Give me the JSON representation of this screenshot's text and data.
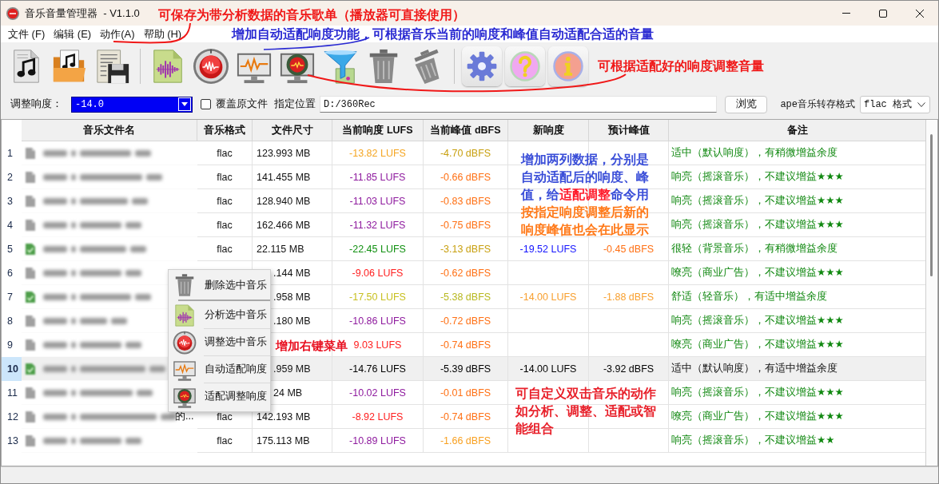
{
  "window": {
    "title": "音乐音量管理器  - V1.1.0"
  },
  "menu": [
    {
      "label": "文件 (F)"
    },
    {
      "label": "编辑 (E)"
    },
    {
      "label": "动作(A)"
    },
    {
      "label": "帮助 (H)"
    }
  ],
  "options": {
    "loudness": {
      "label": "调整响度：",
      "value": "-14.0",
      "highlighted": true
    },
    "overwrite": {
      "label": "覆盖原文件",
      "checked": false
    },
    "location": {
      "label": "指定位置",
      "value": "D:/360Rec"
    },
    "browse_button": "浏览",
    "ape_format": {
      "label": "ape音乐转存格式",
      "value": "flac 格式"
    }
  },
  "table": {
    "columns": [
      "音乐文件名",
      "音乐格式",
      "文件尺寸",
      "当前响度 LUFS",
      "当前峰值 dBFS",
      "新响度",
      "预计峰值",
      "备注"
    ],
    "rows": [
      {
        "number": "1",
        "processed": false,
        "selected": false,
        "format": "flac",
        "size": "123.993 MB",
        "lufs": {
          "text": "-13.82 LUFS",
          "color": "#f5a623"
        },
        "peak": {
          "text": "-4.70 dBFS",
          "color": "#c8a010"
        },
        "note": "适中（默认响度），有稍微增益余度"
      },
      {
        "number": "2",
        "processed": false,
        "selected": false,
        "format": "flac",
        "size": "141.455 MB",
        "lufs": {
          "text": "-11.85 LUFS",
          "color": "#8e1a9e"
        },
        "peak": {
          "text": "-0.66 dBFS",
          "color": "#ff7014"
        },
        "note": "响亮（摇滚音乐），不建议增益★★★"
      },
      {
        "number": "3",
        "processed": false,
        "selected": false,
        "format": "flac",
        "size": "128.940 MB",
        "lufs": {
          "text": "-11.03 LUFS",
          "color": "#8e1a9e"
        },
        "peak": {
          "text": "-0.83 dBFS",
          "color": "#ff7014"
        },
        "note": "响亮（摇滚音乐），不建议增益★★★"
      },
      {
        "number": "4",
        "processed": false,
        "selected": false,
        "format": "flac",
        "size": "162.466 MB",
        "lufs": {
          "text": "-11.32 LUFS",
          "color": "#8e1a9e"
        },
        "peak": {
          "text": "-0.75 dBFS",
          "color": "#ff7014"
        },
        "note": "响亮（摇滚音乐），不建议增益★★★"
      },
      {
        "number": "5",
        "processed": true,
        "selected": false,
        "format": "flac",
        "size": "22.115 MB",
        "lufs": {
          "text": "-22.45 LUFS",
          "color": "#109010"
        },
        "peak": {
          "text": "-3.13 dBFS",
          "color": "#c8a010"
        },
        "new_lufs": {
          "text": "-19.52 LUFS",
          "color": "#1414ff"
        },
        "new_peak": {
          "text": "-0.45 dBFS",
          "color": "#ff7014"
        },
        "note": "很轻（背景音乐），有稍微增益余度"
      },
      {
        "number": "6",
        "processed": false,
        "selected": false,
        "size": ".144 MB",
        "lufs": {
          "text": "-9.06 LUFS",
          "color": "#ff1e1e"
        },
        "peak": {
          "text": "-0.62 dBFS",
          "color": "#ff7014"
        },
        "note": "嘹亮（商业广告），不建议增益★★★"
      },
      {
        "number": "7",
        "processed": true,
        "selected": false,
        "size": ".958 MB",
        "lufs": {
          "text": "-17.50 LUFS",
          "color": "#c8c020"
        },
        "peak": {
          "text": "-5.38 dBFS",
          "color": "#b8b820"
        },
        "new_lufs": {
          "text": "-14.00 LUFS",
          "color": "#f8a030"
        },
        "new_peak": {
          "text": "-1.88 dBFS",
          "color": "#f8a030"
        },
        "note": "舒适（轻音乐），有适中增益余度"
      },
      {
        "number": "8",
        "processed": false,
        "selected": false,
        "size": ".180 MB",
        "lufs": {
          "text": "-10.86 LUFS",
          "color": "#8e1a9e"
        },
        "peak": {
          "text": "-0.72 dBFS",
          "color": "#ff7014"
        },
        "note": "响亮（摇滚音乐），不建议增益★★★"
      },
      {
        "number": "9",
        "processed": false,
        "selected": false,
        "lufs": {
          "text": "9.03 LUFS",
          "color": "#ff1e1e"
        },
        "peak": {
          "text": "-0.74 dBFS",
          "color": "#ff7014"
        },
        "note": "嘹亮（商业广告），不建议增益★★★"
      },
      {
        "number": "10",
        "processed": true,
        "selected": true,
        "size": ".959 MB",
        "lufs": {
          "text": "-14.76 LUFS",
          "color": "#000000"
        },
        "peak": {
          "text": "-5.39 dBFS",
          "color": "#000000"
        },
        "new_lufs": {
          "text": "-14.00 LUFS",
          "color": "#000000"
        },
        "new_peak": {
          "text": "-3.92 dBFS",
          "color": "#000000"
        },
        "note": "适中（默认响度），有适中增益余度"
      },
      {
        "number": "11",
        "processed": false,
        "selected": false,
        "size": "24 MB",
        "lufs": {
          "text": "-10.02 LUFS",
          "color": "#8e1a9e"
        },
        "peak": {
          "text": "-0.01 dBFS",
          "color": "#ff7014"
        },
        "note": "响亮（摇滚音乐），不建议增益★★★"
      },
      {
        "number": "12",
        "processed": false,
        "selected": false,
        "name_tail": "的...",
        "format": "flac",
        "size": "142.193 MB",
        "lufs": {
          "text": "-8.92 LUFS",
          "color": "#ff1e1e"
        },
        "peak": {
          "text": "-0.74 dBFS",
          "color": "#ff7014"
        },
        "note": "嘹亮（商业广告），不建议增益★★★"
      },
      {
        "number": "13",
        "processed": false,
        "selected": false,
        "format": "flac",
        "size": "175.113 MB",
        "lufs": {
          "text": "-10.89 LUFS",
          "color": "#8e1a9e"
        },
        "peak": {
          "text": "-1.66 dBFS",
          "color": "#f8a020"
        },
        "note": "响亮（摇滚音乐），不建议增益★★"
      }
    ]
  },
  "context_menu": {
    "sections": [
      [
        {
          "label": "删除选中音乐"
        }
      ],
      [
        {
          "label": "分析选中音乐"
        },
        {
          "label": "调整选中音乐"
        },
        {
          "label": "自动适配响度"
        },
        {
          "label": "适配调整响度"
        }
      ]
    ]
  },
  "annotations": [
    {
      "segments": [
        {
          "text": "可保存为带分析数据的音乐歌单（播放器可直接使用）",
          "color": "#f01818"
        }
      ]
    },
    {
      "segments": [
        {
          "text": "增加自动适配响度功能，可根据音乐当前的响度和峰值自动适配合适的音量",
          "color": "#2a2ad2"
        }
      ]
    },
    {
      "segments": [
        {
          "text": "可根据适配好的响度调整音量",
          "color": "#f01818"
        }
      ]
    },
    {
      "segments": [
        {
          "text": "增加两列数据，分别是自动适配后的响度、峰值，给",
          "color": "#3a4ed8"
        },
        {
          "text": "适配调整",
          "color": "#ff1a2a"
        },
        {
          "text": "命令用",
          "color": "#3a4ed8"
        },
        {
          "text": "按指定响度调整后新的响度峰值也会在此显示",
          "color": "#ff7a1a"
        }
      ]
    },
    {
      "segments": [
        {
          "text": "增加右键菜单",
          "color": "#e81020"
        }
      ]
    },
    {
      "segments": [
        {
          "text": "可自定义双击音乐的动作如分析、调整、适配或智能组合",
          "color": "#e8202a"
        }
      ]
    }
  ]
}
